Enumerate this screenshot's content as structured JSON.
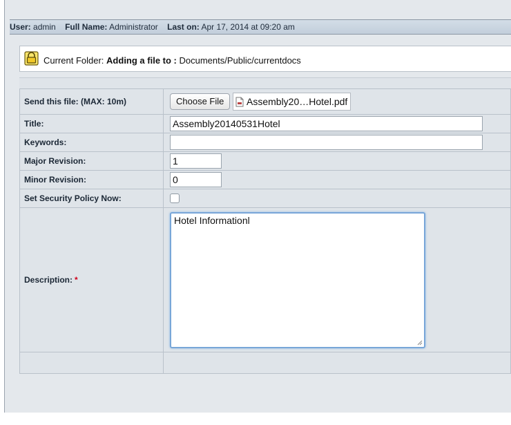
{
  "userbar": {
    "user_label": "User:",
    "user_value": "admin",
    "fullname_label": "Full Name:",
    "fullname_value": "Administrator",
    "laston_label": "Last on:",
    "laston_value": "Apr 17, 2014 at 09:20 am"
  },
  "folder": {
    "prefix": "Current Folder:",
    "adding": "Adding a file to :",
    "path": "Documents/Public/currentdocs",
    "icon": "lock-icon"
  },
  "form": {
    "send_file_label": "Send this file: (MAX: 10m)",
    "choose_file_label": "Choose File",
    "file_name": "Assembly20…Hotel.pdf",
    "title_label": "Title:",
    "title_value": "Assembly20140531Hotel",
    "keywords_label": "Keywords:",
    "keywords_value": "",
    "major_label": "Major Revision:",
    "major_value": "1",
    "minor_label": "Minor Revision:",
    "minor_value": "0",
    "security_label": "Set Security Policy Now:",
    "security_checked": false,
    "description_label": "Description:",
    "required_marker": "*",
    "description_value": "Hotel Informationl"
  },
  "colors": {
    "header_bg": "#c8d3df",
    "row_bg": "#dfe4e9",
    "focus_border": "#78a6d8",
    "required": "#d0021b"
  }
}
